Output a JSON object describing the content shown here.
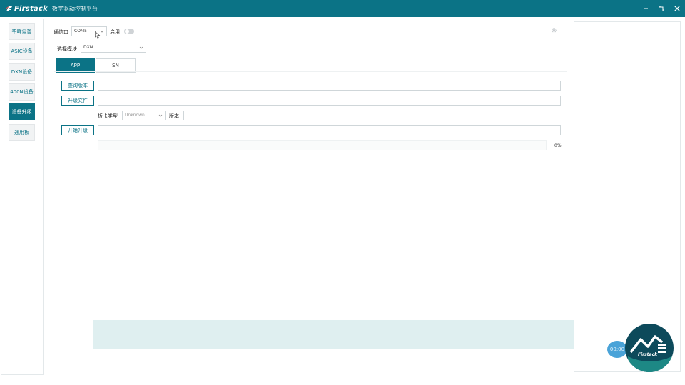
{
  "titlebar": {
    "brand": "Firstack",
    "app_title": "数字驱动控制平台"
  },
  "sidebar": {
    "items": [
      {
        "label": "华峰设备"
      },
      {
        "label": "ASIC设备"
      },
      {
        "label": "DXN设备"
      },
      {
        "label": "400N设备"
      },
      {
        "label": "设备升级",
        "active": true
      },
      {
        "label": "通用板"
      }
    ]
  },
  "toolbar": {
    "port_label": "通信口",
    "port_value": "COM5",
    "enable_label": "启用",
    "module_label": "选择模块",
    "module_value": "DXN"
  },
  "tabs": [
    {
      "label": "APP",
      "active": true
    },
    {
      "label": "SN"
    }
  ],
  "app_panel": {
    "query_version_button": "查询版本",
    "upgrade_file_button": "升级文件",
    "card_type_label": "板卡类型",
    "card_type_value": "Unknown",
    "version_label": "版本",
    "start_upgrade_button": "开始升级",
    "progress_percent": 0,
    "progress_text": "0%"
  },
  "floating": {
    "timer": "00:00",
    "logo_text": "Firstack"
  },
  "colors": {
    "accent": "#0b7386",
    "timer": "#4aa3d8",
    "logo_bg": "#0d4a5b"
  }
}
